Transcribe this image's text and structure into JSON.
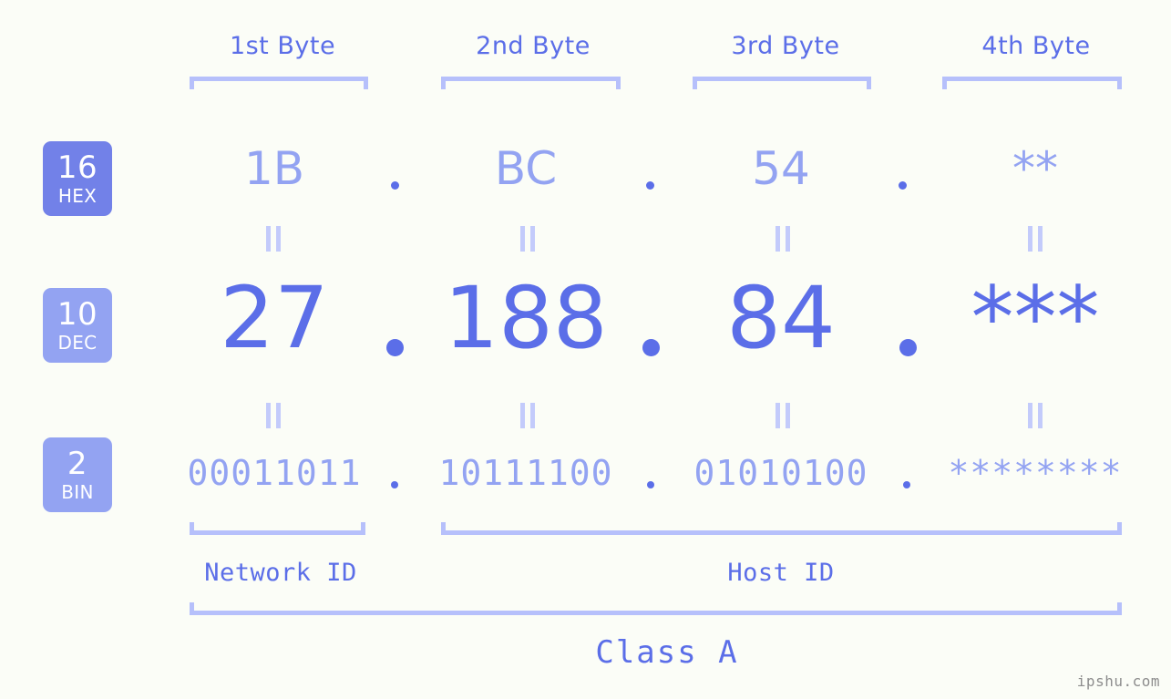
{
  "watermark": "ipshu.com",
  "byte_headers": [
    {
      "label": "1st Byte"
    },
    {
      "label": "2nd Byte"
    },
    {
      "label": "3rd Byte"
    },
    {
      "label": "4th Byte"
    }
  ],
  "bases": [
    {
      "number": "16",
      "name": "HEX",
      "color": "#7281e8"
    },
    {
      "number": "10",
      "name": "DEC",
      "color": "#93a3f2"
    },
    {
      "number": "2",
      "name": "BIN",
      "color": "#93a3f2"
    }
  ],
  "rows": {
    "hex": {
      "values": [
        "1B",
        "BC",
        "54",
        "**"
      ],
      "separator": "."
    },
    "dec": {
      "values": [
        "27",
        "188",
        "84",
        "***"
      ],
      "separator": "."
    },
    "bin": {
      "values": [
        "00011011",
        "10111100",
        "01010100",
        "********"
      ],
      "separator": "."
    }
  },
  "segments": {
    "network_id": "Network ID",
    "host_id": "Host ID",
    "class": "Class A"
  },
  "colors": {
    "background": "#fbfdf7",
    "accent_strong": "#5b6ee8",
    "accent_light": "#93a3f2",
    "bracket": "#b6c0fb",
    "equal_mark": "#c3cbfb",
    "watermark": "#8d8d8d"
  }
}
